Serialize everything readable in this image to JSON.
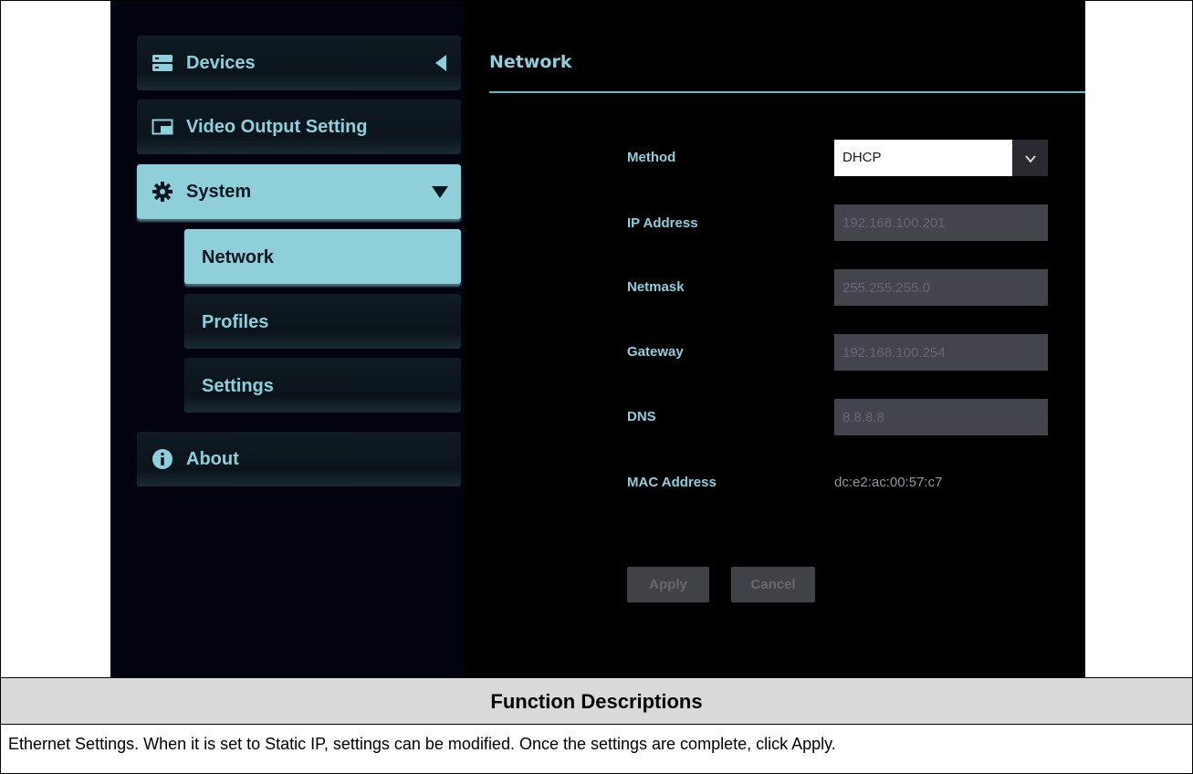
{
  "sidebar": {
    "items": [
      {
        "label": "Devices",
        "icon": "server-icon",
        "arrow": "left-triangle"
      },
      {
        "label": "Video Output Setting",
        "icon": "window-icon"
      },
      {
        "label": "System",
        "icon": "gear-icon",
        "arrow": "down-triangle",
        "active": true
      },
      {
        "label": "About",
        "icon": "info-icon"
      }
    ],
    "subitems": [
      {
        "label": "Network",
        "active": true
      },
      {
        "label": "Profiles"
      },
      {
        "label": "Settings"
      }
    ]
  },
  "main": {
    "title": "Network",
    "fields": {
      "method": {
        "label": "Method",
        "value": "DHCP"
      },
      "ip": {
        "label": "IP Address",
        "value": "192.168.100.201"
      },
      "netmask": {
        "label": "Netmask",
        "value": "255.255.255.0"
      },
      "gateway": {
        "label": "Gateway",
        "value": "192.168.100.254"
      },
      "dns": {
        "label": "DNS",
        "value": "8.8.8.8"
      },
      "mac": {
        "label": "MAC Address",
        "value": "dc:e2:ac:00:57:c7"
      }
    },
    "buttons": {
      "apply": "Apply",
      "cancel": "Cancel"
    }
  },
  "description": {
    "header": "Function Descriptions",
    "text": "Ethernet Settings. When it is set to Static IP, settings can be modified. Once the settings are complete, click Apply."
  },
  "colors": {
    "accent": "#8ecfda",
    "background": "#000000",
    "disabled_input": "#44444c"
  }
}
